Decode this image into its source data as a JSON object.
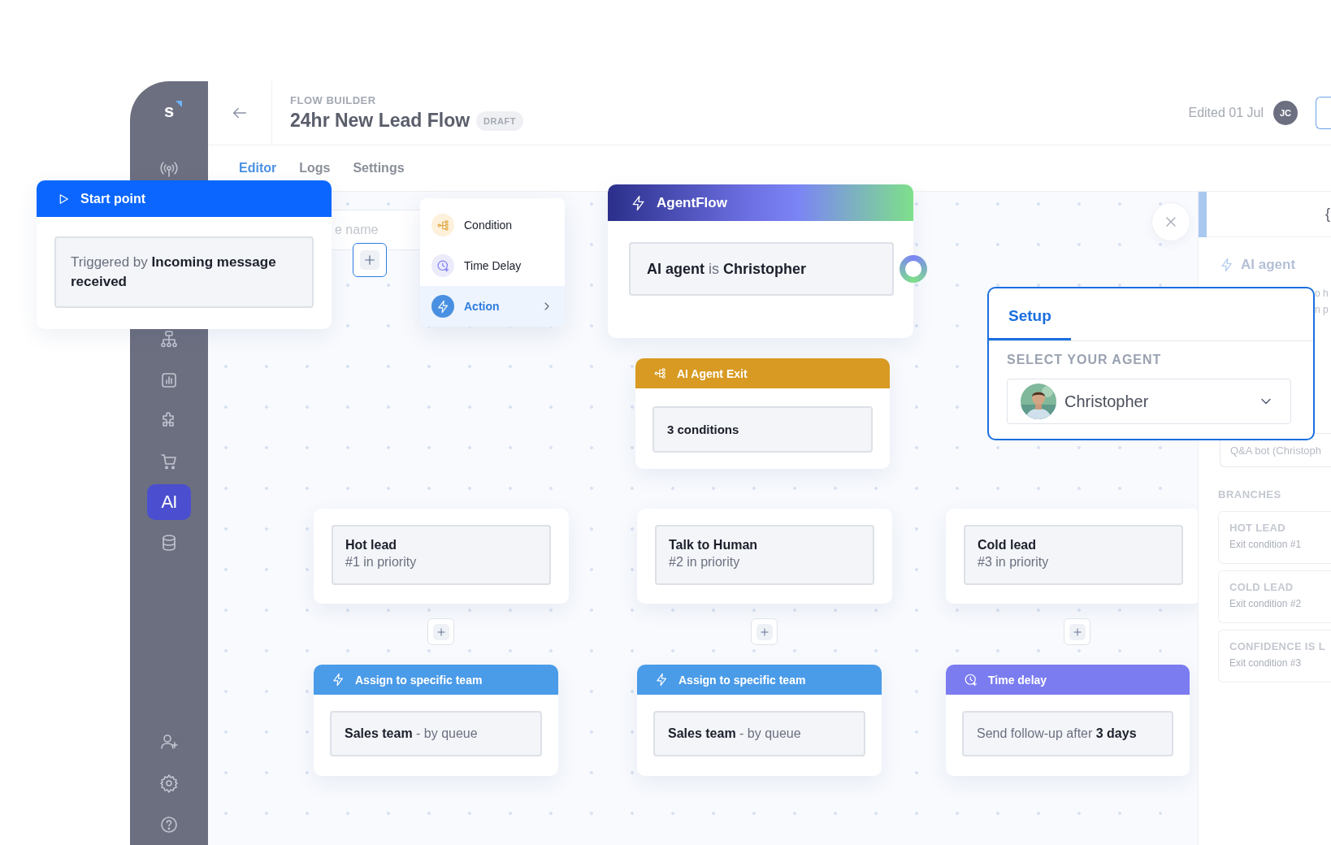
{
  "sidebar": {
    "logo": "s",
    "items": [
      {
        "kind": "broadcast",
        "selected": false
      },
      {
        "kind": "hierarchy",
        "selected": false
      },
      {
        "kind": "chart",
        "selected": false
      },
      {
        "kind": "puzzle",
        "selected": false
      },
      {
        "kind": "cart",
        "selected": false
      },
      {
        "kind": "ai",
        "label": "AI",
        "selected": true
      },
      {
        "kind": "database",
        "selected": false
      }
    ],
    "footer_items": [
      {
        "kind": "user-add",
        "selected": false
      },
      {
        "kind": "settings",
        "selected": false
      },
      {
        "kind": "help",
        "selected": false
      }
    ]
  },
  "header": {
    "eyebrow": "FLOW BUILDER",
    "title": "24hr New Lead Flow",
    "badge": "DRAFT",
    "edited": "Edited 01 Jul",
    "avatar": "JC"
  },
  "tabs": [
    {
      "label": "Editor",
      "selected": true
    },
    {
      "label": "Logs",
      "selected": false
    },
    {
      "label": "Settings",
      "selected": false
    }
  ],
  "start_node": {
    "title": "Start point",
    "text": "Triggered by **Incoming message received**"
  },
  "name_field": {
    "placeholder": "e name"
  },
  "add_menu": [
    {
      "kind": "condition",
      "label": "Condition",
      "selected": false
    },
    {
      "kind": "delay",
      "label": "Time Delay",
      "selected": false
    },
    {
      "kind": "action",
      "label": "Action",
      "selected": true
    }
  ],
  "agent_node": {
    "title": "AgentFlow",
    "text": "**AI agent** is **Christopher**"
  },
  "exit_node": {
    "title": "AI Agent Exit",
    "text": "3 conditions"
  },
  "branches": [
    {
      "title": "Hot lead",
      "subtitle": "#1 in priority"
    },
    {
      "title": "Talk to Human",
      "subtitle": "#2 in priority"
    },
    {
      "title": "Cold lead",
      "subtitle": "#3 in priority"
    }
  ],
  "actions": [
    {
      "kind": "assign",
      "title": "Assign to specific team",
      "text": "**Sales team** - by queue"
    },
    {
      "kind": "assign",
      "title": "Assign to specific team",
      "text": "**Sales team** - by queue"
    },
    {
      "kind": "delay",
      "title": "Time delay",
      "text": "Send follow-up after **3 days**"
    }
  ],
  "setup": {
    "tab": "Setup",
    "label": "SELECT YOUR AGENT",
    "value": "Christopher"
  },
  "side_panel": {
    "header": "{",
    "title": "AI agent",
    "snippets": [
      "o h",
      "n p"
    ],
    "field": "Q&A bot (Christoph",
    "branches_label": "BRANCHES",
    "branches": [
      {
        "title": "HOT LEAD",
        "subtitle": "Exit condition #1"
      },
      {
        "title": "COLD LEAD",
        "subtitle": "Exit condition #2"
      },
      {
        "title": "CONFIDENCE IS L",
        "subtitle": "Exit condition #3"
      }
    ]
  }
}
